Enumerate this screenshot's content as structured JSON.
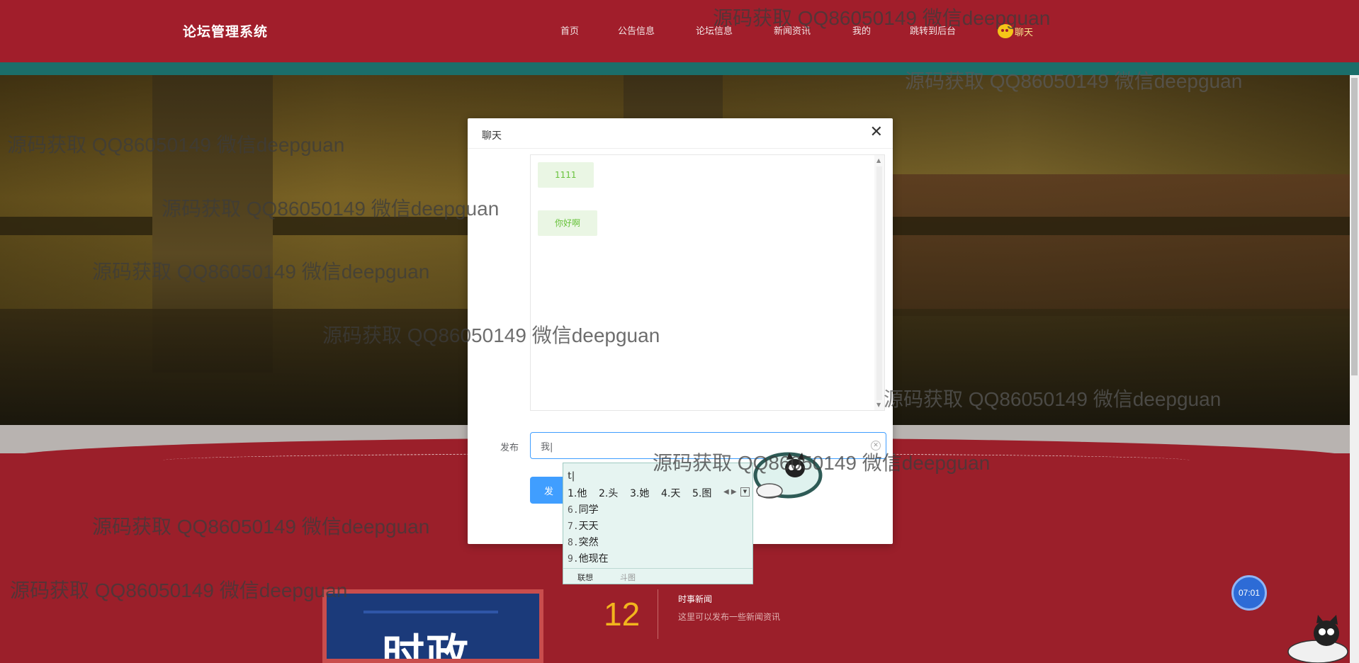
{
  "header": {
    "logo": "论坛管理系统",
    "nav": [
      "首页",
      "公告信息",
      "论坛信息",
      "新闻资讯",
      "我的",
      "跳转到后台"
    ],
    "chat_link": "聊天"
  },
  "modal": {
    "title": "聊天",
    "close_glyph": "✕",
    "messages": [
      "1111",
      "你好啊"
    ],
    "form_label": "发布",
    "input_value": "我|",
    "send_label": "发"
  },
  "ime": {
    "pinyin": "t|",
    "candidates": [
      {
        "num": "1.",
        "text": "他"
      },
      {
        "num": "2.",
        "text": "头"
      },
      {
        "num": "3.",
        "text": "她"
      },
      {
        "num": "4.",
        "text": "天"
      },
      {
        "num": "5.",
        "text": "图"
      }
    ],
    "more_candidates": [
      {
        "num": "6.",
        "text": "同学"
      },
      {
        "num": "7.",
        "text": "天天"
      },
      {
        "num": "8.",
        "text": "突然"
      },
      {
        "num": "9.",
        "text": "他现在"
      }
    ],
    "tabs": [
      "联想",
      "斗图"
    ]
  },
  "news": {
    "image_title": "时政",
    "day": "12",
    "title": "时事新闻",
    "desc": "这里可以发布一些新闻资讯"
  },
  "timer": "07:01",
  "watermark": "源码获取 QQ86050149 微信deepguan",
  "colors": {
    "header_bg": "#a11e2b",
    "accent_teal": "#1b6e6a",
    "primary_blue": "#409eff",
    "bubble_green": "#67c23a",
    "news_day": "#f2b51d"
  }
}
